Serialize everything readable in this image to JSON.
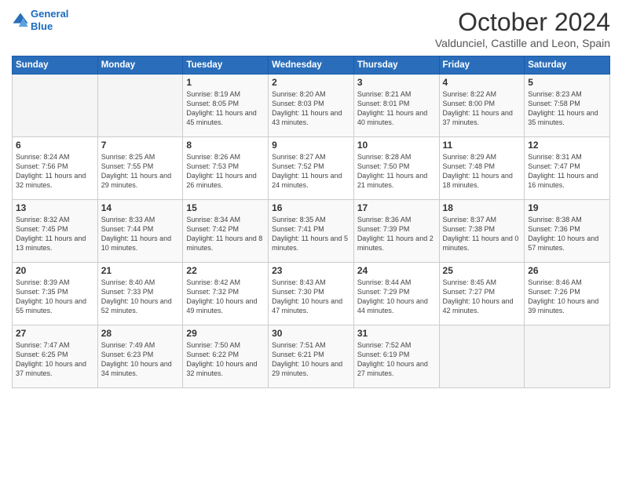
{
  "header": {
    "logo_line1": "General",
    "logo_line2": "Blue",
    "month": "October 2024",
    "location": "Valdunciel, Castille and Leon, Spain"
  },
  "days_of_week": [
    "Sunday",
    "Monday",
    "Tuesday",
    "Wednesday",
    "Thursday",
    "Friday",
    "Saturday"
  ],
  "weeks": [
    [
      {
        "day": "",
        "info": ""
      },
      {
        "day": "",
        "info": ""
      },
      {
        "day": "1",
        "info": "Sunrise: 8:19 AM\nSunset: 8:05 PM\nDaylight: 11 hours and 45 minutes."
      },
      {
        "day": "2",
        "info": "Sunrise: 8:20 AM\nSunset: 8:03 PM\nDaylight: 11 hours and 43 minutes."
      },
      {
        "day": "3",
        "info": "Sunrise: 8:21 AM\nSunset: 8:01 PM\nDaylight: 11 hours and 40 minutes."
      },
      {
        "day": "4",
        "info": "Sunrise: 8:22 AM\nSunset: 8:00 PM\nDaylight: 11 hours and 37 minutes."
      },
      {
        "day": "5",
        "info": "Sunrise: 8:23 AM\nSunset: 7:58 PM\nDaylight: 11 hours and 35 minutes."
      }
    ],
    [
      {
        "day": "6",
        "info": "Sunrise: 8:24 AM\nSunset: 7:56 PM\nDaylight: 11 hours and 32 minutes."
      },
      {
        "day": "7",
        "info": "Sunrise: 8:25 AM\nSunset: 7:55 PM\nDaylight: 11 hours and 29 minutes."
      },
      {
        "day": "8",
        "info": "Sunrise: 8:26 AM\nSunset: 7:53 PM\nDaylight: 11 hours and 26 minutes."
      },
      {
        "day": "9",
        "info": "Sunrise: 8:27 AM\nSunset: 7:52 PM\nDaylight: 11 hours and 24 minutes."
      },
      {
        "day": "10",
        "info": "Sunrise: 8:28 AM\nSunset: 7:50 PM\nDaylight: 11 hours and 21 minutes."
      },
      {
        "day": "11",
        "info": "Sunrise: 8:29 AM\nSunset: 7:48 PM\nDaylight: 11 hours and 18 minutes."
      },
      {
        "day": "12",
        "info": "Sunrise: 8:31 AM\nSunset: 7:47 PM\nDaylight: 11 hours and 16 minutes."
      }
    ],
    [
      {
        "day": "13",
        "info": "Sunrise: 8:32 AM\nSunset: 7:45 PM\nDaylight: 11 hours and 13 minutes."
      },
      {
        "day": "14",
        "info": "Sunrise: 8:33 AM\nSunset: 7:44 PM\nDaylight: 11 hours and 10 minutes."
      },
      {
        "day": "15",
        "info": "Sunrise: 8:34 AM\nSunset: 7:42 PM\nDaylight: 11 hours and 8 minutes."
      },
      {
        "day": "16",
        "info": "Sunrise: 8:35 AM\nSunset: 7:41 PM\nDaylight: 11 hours and 5 minutes."
      },
      {
        "day": "17",
        "info": "Sunrise: 8:36 AM\nSunset: 7:39 PM\nDaylight: 11 hours and 2 minutes."
      },
      {
        "day": "18",
        "info": "Sunrise: 8:37 AM\nSunset: 7:38 PM\nDaylight: 11 hours and 0 minutes."
      },
      {
        "day": "19",
        "info": "Sunrise: 8:38 AM\nSunset: 7:36 PM\nDaylight: 10 hours and 57 minutes."
      }
    ],
    [
      {
        "day": "20",
        "info": "Sunrise: 8:39 AM\nSunset: 7:35 PM\nDaylight: 10 hours and 55 minutes."
      },
      {
        "day": "21",
        "info": "Sunrise: 8:40 AM\nSunset: 7:33 PM\nDaylight: 10 hours and 52 minutes."
      },
      {
        "day": "22",
        "info": "Sunrise: 8:42 AM\nSunset: 7:32 PM\nDaylight: 10 hours and 49 minutes."
      },
      {
        "day": "23",
        "info": "Sunrise: 8:43 AM\nSunset: 7:30 PM\nDaylight: 10 hours and 47 minutes."
      },
      {
        "day": "24",
        "info": "Sunrise: 8:44 AM\nSunset: 7:29 PM\nDaylight: 10 hours and 44 minutes."
      },
      {
        "day": "25",
        "info": "Sunrise: 8:45 AM\nSunset: 7:27 PM\nDaylight: 10 hours and 42 minutes."
      },
      {
        "day": "26",
        "info": "Sunrise: 8:46 AM\nSunset: 7:26 PM\nDaylight: 10 hours and 39 minutes."
      }
    ],
    [
      {
        "day": "27",
        "info": "Sunrise: 7:47 AM\nSunset: 6:25 PM\nDaylight: 10 hours and 37 minutes."
      },
      {
        "day": "28",
        "info": "Sunrise: 7:49 AM\nSunset: 6:23 PM\nDaylight: 10 hours and 34 minutes."
      },
      {
        "day": "29",
        "info": "Sunrise: 7:50 AM\nSunset: 6:22 PM\nDaylight: 10 hours and 32 minutes."
      },
      {
        "day": "30",
        "info": "Sunrise: 7:51 AM\nSunset: 6:21 PM\nDaylight: 10 hours and 29 minutes."
      },
      {
        "day": "31",
        "info": "Sunrise: 7:52 AM\nSunset: 6:19 PM\nDaylight: 10 hours and 27 minutes."
      },
      {
        "day": "",
        "info": ""
      },
      {
        "day": "",
        "info": ""
      }
    ]
  ]
}
